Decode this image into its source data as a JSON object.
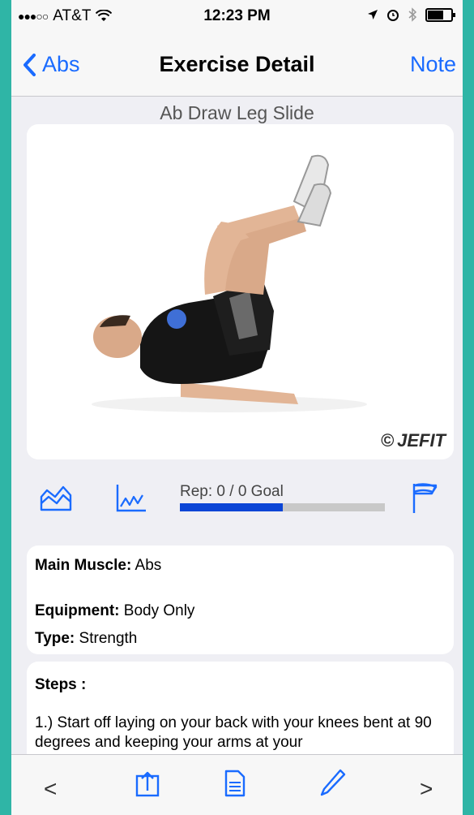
{
  "status": {
    "carrier": "AT&T",
    "time": "12:23 PM"
  },
  "nav": {
    "back_label": "Abs",
    "title": "Exercise Detail",
    "right_label": "Note"
  },
  "exercise": {
    "name": "Ab Draw Leg Slide",
    "watermark": "JEFIT"
  },
  "tools": {
    "rep_label": "Rep: 0 / 0 Goal",
    "rep_progress": 0.5
  },
  "info": {
    "main_muscle_label": "Main Muscle:",
    "main_muscle_value": "Abs",
    "equipment_label": "Equipment:",
    "equipment_value": "Body Only",
    "type_label": "Type:",
    "type_value": "Strength"
  },
  "steps": {
    "heading": "Steps :",
    "text": "1.) Start off laying on your back with your knees bent at 90 degrees and keeping your arms at your"
  },
  "bottom": {
    "prev_label": "<",
    "next_label": ">"
  },
  "colors": {
    "accent": "#1a6bff",
    "progress_fill": "#0b45d6",
    "frame": "#2fb5a6"
  }
}
